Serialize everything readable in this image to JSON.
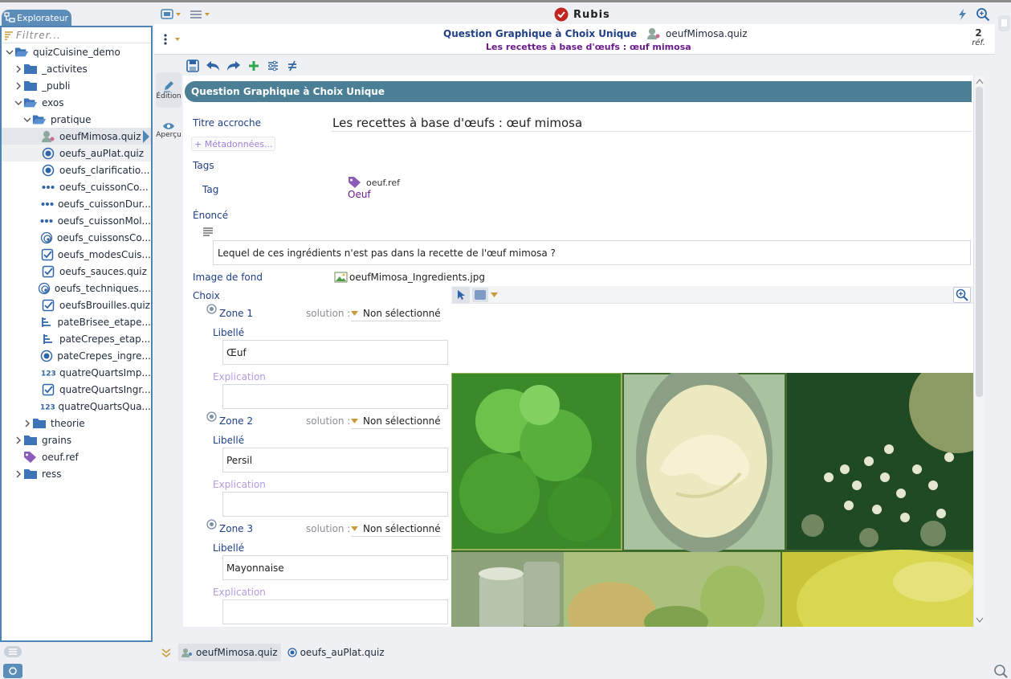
{
  "app": {
    "title": "Rubis"
  },
  "explorer": {
    "tab_label": "Explorateur",
    "filter_placeholder": "Filtrer...",
    "items": [
      {
        "label": "quizCuisine_demo",
        "icon": "folder-open-icon",
        "depth": 0,
        "expanded": true
      },
      {
        "label": "_activites",
        "icon": "folder-icon",
        "depth": 1,
        "expanded": false
      },
      {
        "label": "_publi",
        "icon": "folder-icon",
        "depth": 1,
        "expanded": false
      },
      {
        "label": "exos",
        "icon": "folder-open-icon",
        "depth": 1,
        "expanded": true
      },
      {
        "label": "pratique",
        "icon": "folder-open-icon",
        "depth": 2,
        "expanded": true
      },
      {
        "label": "oeufMimosa.quiz",
        "icon": "graphic-choice-icon",
        "depth": 3,
        "selected": true
      },
      {
        "label": "oeufs_auPlat.quiz",
        "icon": "radio-choice-icon",
        "depth": 3
      },
      {
        "label": "oeufs_clarificatio...",
        "icon": "radio-choice-icon",
        "depth": 3
      },
      {
        "label": "oeufs_cuissonCo...",
        "icon": "dots-icon",
        "depth": 3
      },
      {
        "label": "oeufs_cuissonDur...",
        "icon": "dots-icon",
        "depth": 3
      },
      {
        "label": "oeufs_cuissonMol...",
        "icon": "dots-icon",
        "depth": 3
      },
      {
        "label": "oeufs_cuissonsCo...",
        "icon": "spiral-icon",
        "depth": 3
      },
      {
        "label": "oeufs_modesCuis...",
        "icon": "checkbox-icon",
        "depth": 3
      },
      {
        "label": "oeufs_sauces.quiz",
        "icon": "checkbox-icon",
        "depth": 3
      },
      {
        "label": "oeufs_techniques....",
        "icon": "spiral-icon",
        "depth": 3
      },
      {
        "label": "oeufsBrouilles.quiz",
        "icon": "checkbox-icon",
        "depth": 3
      },
      {
        "label": "pateBrisee_etape...",
        "icon": "order-icon",
        "depth": 3
      },
      {
        "label": "pateCrepes_etap...",
        "icon": "order-icon",
        "depth": 3
      },
      {
        "label": "pateCrepes_ingre...",
        "icon": "radio-choice-icon",
        "depth": 3
      },
      {
        "label": "quatreQuartsImp...",
        "icon": "numeric-icon",
        "depth": 3
      },
      {
        "label": "quatreQuartsIngr...",
        "icon": "checkbox-icon",
        "depth": 3
      },
      {
        "label": "quatreQuartsQua...",
        "icon": "numeric-icon",
        "depth": 3
      },
      {
        "label": "theorie",
        "icon": "folder-icon",
        "depth": 2,
        "expanded": false
      },
      {
        "label": "grains",
        "icon": "folder-icon",
        "depth": 1,
        "expanded": false
      },
      {
        "label": "oeuf.ref",
        "icon": "tag-icon",
        "depth": 1
      },
      {
        "label": "ress",
        "icon": "folder-icon",
        "depth": 1,
        "expanded": false
      }
    ]
  },
  "header": {
    "title": "Question Graphique à Choix Unique",
    "filename": "oeufMimosa.quiz",
    "subtitle": "Les recettes à base d'œufs : œuf mimosa",
    "refs_count": "2",
    "refs_label": "réf."
  },
  "side": {
    "edit_label": "Édition",
    "preview_label": "Aperçu"
  },
  "form": {
    "section_title": "Question Graphique à Choix Unique",
    "titre_label": "Titre accroche",
    "titre_value": "Les recettes à base d'œufs : œuf mimosa",
    "metadata_btn": "+ Métadonnées...",
    "tags_label": "Tags",
    "tag_label": "Tag",
    "tag_ref": "oeuf.ref",
    "tag_name": "Oeuf",
    "enonce_label": "Énoncé",
    "enonce_value": "Lequel de ces ingrédients n'est pas dans la recette de l'œuf mimosa ?",
    "image_label": "Image de fond",
    "image_file": "oeufMimosa_Ingredients.jpg",
    "choix_label": "Choix",
    "zones": [
      {
        "name": "Zone 1",
        "solution_label": "solution :",
        "solution_value": "Non sélectionné",
        "libelle_label": "Libellé",
        "libelle_value": "Œuf",
        "explication_label": "Explication",
        "explication_value": ""
      },
      {
        "name": "Zone 2",
        "solution_label": "solution :",
        "solution_value": "Non sélectionné",
        "libelle_label": "Libellé",
        "libelle_value": "Persil",
        "explication_label": "Explication",
        "explication_value": ""
      },
      {
        "name": "Zone 3",
        "solution_label": "solution :",
        "solution_value": "Non sélectionné",
        "libelle_label": "Libellé",
        "libelle_value": "Mayonnaise",
        "explication_label": "Explication",
        "explication_value": ""
      }
    ]
  },
  "bottom_tabs": [
    {
      "label": "oeufMimosa.quiz",
      "active": true
    },
    {
      "label": "oeufs_auPlat.quiz",
      "active": false
    }
  ],
  "colors": {
    "accent": "#4d86b5",
    "section": "#4b7f95",
    "title_blue": "#1f3f86",
    "subtitle_purple": "#6a1a8a",
    "green": "#2fa84f"
  }
}
